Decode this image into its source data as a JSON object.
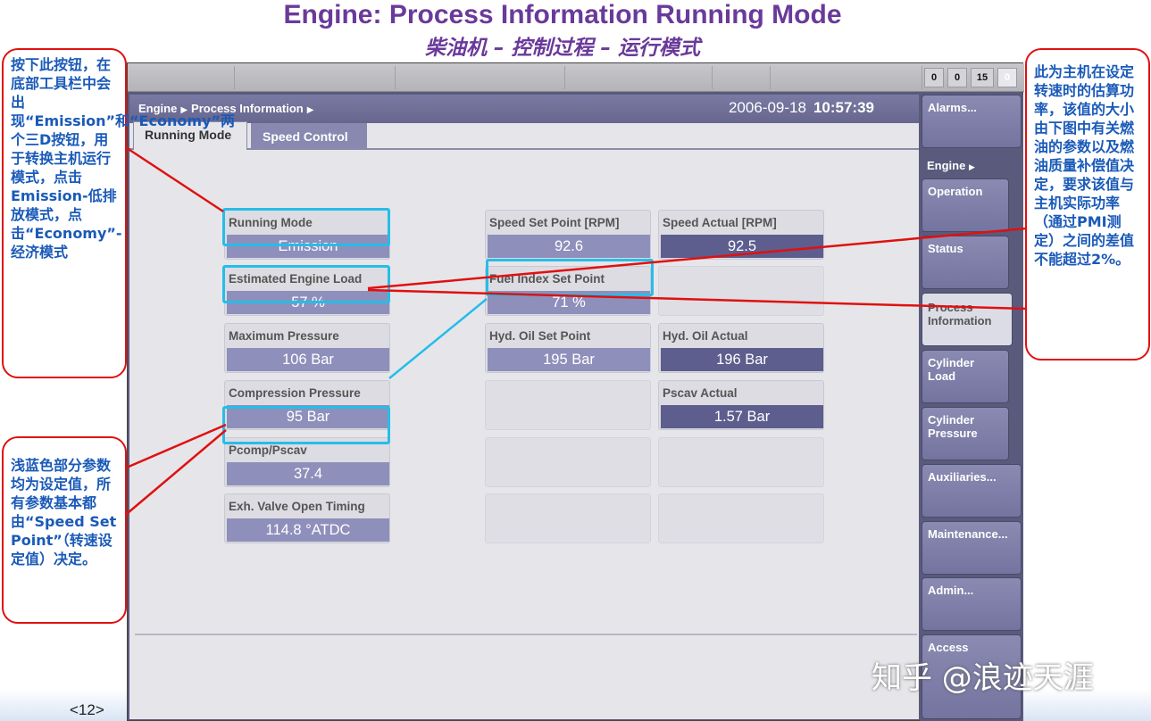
{
  "slide": {
    "title": "Engine: Process Information Running Mode",
    "subtitle": "柴油机 – 控制过程 – 运行模式",
    "page_number": "<12>",
    "watermark": "知乎 @浪迹天涯"
  },
  "topbar": {
    "counters": [
      "0",
      "0",
      "15",
      "0"
    ]
  },
  "header": {
    "breadcrumb": [
      "Engine",
      "Process Information"
    ],
    "date": "2006-09-18",
    "time": "10:57:39"
  },
  "tabs": [
    {
      "label": "Running Mode",
      "active": true
    },
    {
      "label": "Speed Control",
      "active": false
    }
  ],
  "cards": {
    "running_mode": {
      "label": "Running Mode",
      "value": "Emission"
    },
    "estimated_engine_load": {
      "label": "Estimated Engine Load",
      "value": "57 %"
    },
    "maximum_pressure": {
      "label": "Maximum Pressure",
      "value": "106 Bar"
    },
    "compression_pressure": {
      "label": "Compression Pressure",
      "value": "95 Bar"
    },
    "pcomp_pscav": {
      "label": "Pcomp/Pscav",
      "value": "37.4"
    },
    "exh_valve_open_timing": {
      "label": "Exh. Valve Open Timing",
      "value": "114.8 °ATDC"
    },
    "speed_set_point": {
      "label": "Speed Set Point [RPM]",
      "value": "92.6"
    },
    "speed_actual": {
      "label": "Speed Actual [RPM]",
      "value": "92.5"
    },
    "fuel_index_set_point": {
      "label": "Fuel Index Set Point",
      "value": "71 %"
    },
    "hyd_oil_set_point": {
      "label": "Hyd. Oil Set Point",
      "value": "195 Bar"
    },
    "hyd_oil_actual": {
      "label": "Hyd. Oil Actual",
      "value": "196 Bar"
    },
    "pscav_actual": {
      "label": "Pscav Actual",
      "value": "1.57 Bar"
    }
  },
  "sidebar": {
    "alarms": "Alarms...",
    "engine_group": "Engine",
    "engine_items": [
      "Operation",
      "Status",
      "Process Information",
      "Cylinder Load",
      "Cylinder Pressure"
    ],
    "auxiliaries": "Auxiliaries...",
    "maintenance": "Maintenance...",
    "admin": "Admin...",
    "access": "Access"
  },
  "annotations": {
    "left_top": "按下此按钮，在底部工具栏中会出现“Emission”和“Economy”两个三D按钮，用于转换主机运行模式，点击Emission-低排放模式，点击“Economy”-经济模式",
    "left_bottom": "浅蓝色部分参数均为设定值，所有参数基本都由“Speed Set Point”（转速设定值）决定。",
    "right": "此为主机在设定转速时的估算功率，该值的大小由下图中有关燃油的参数以及燃油质量补偿值决定，要求该值与主机实际功率（通过PMI测定）之间的差值不能超过2%。"
  },
  "colors": {
    "title": "#6a3a9a",
    "annotation_border": "#e01010",
    "annotation_text": "#1a5ab8",
    "highlight": "#26bde8",
    "setpoint_value": "#8f8fbc",
    "actual_value": "#5d5d8e"
  }
}
